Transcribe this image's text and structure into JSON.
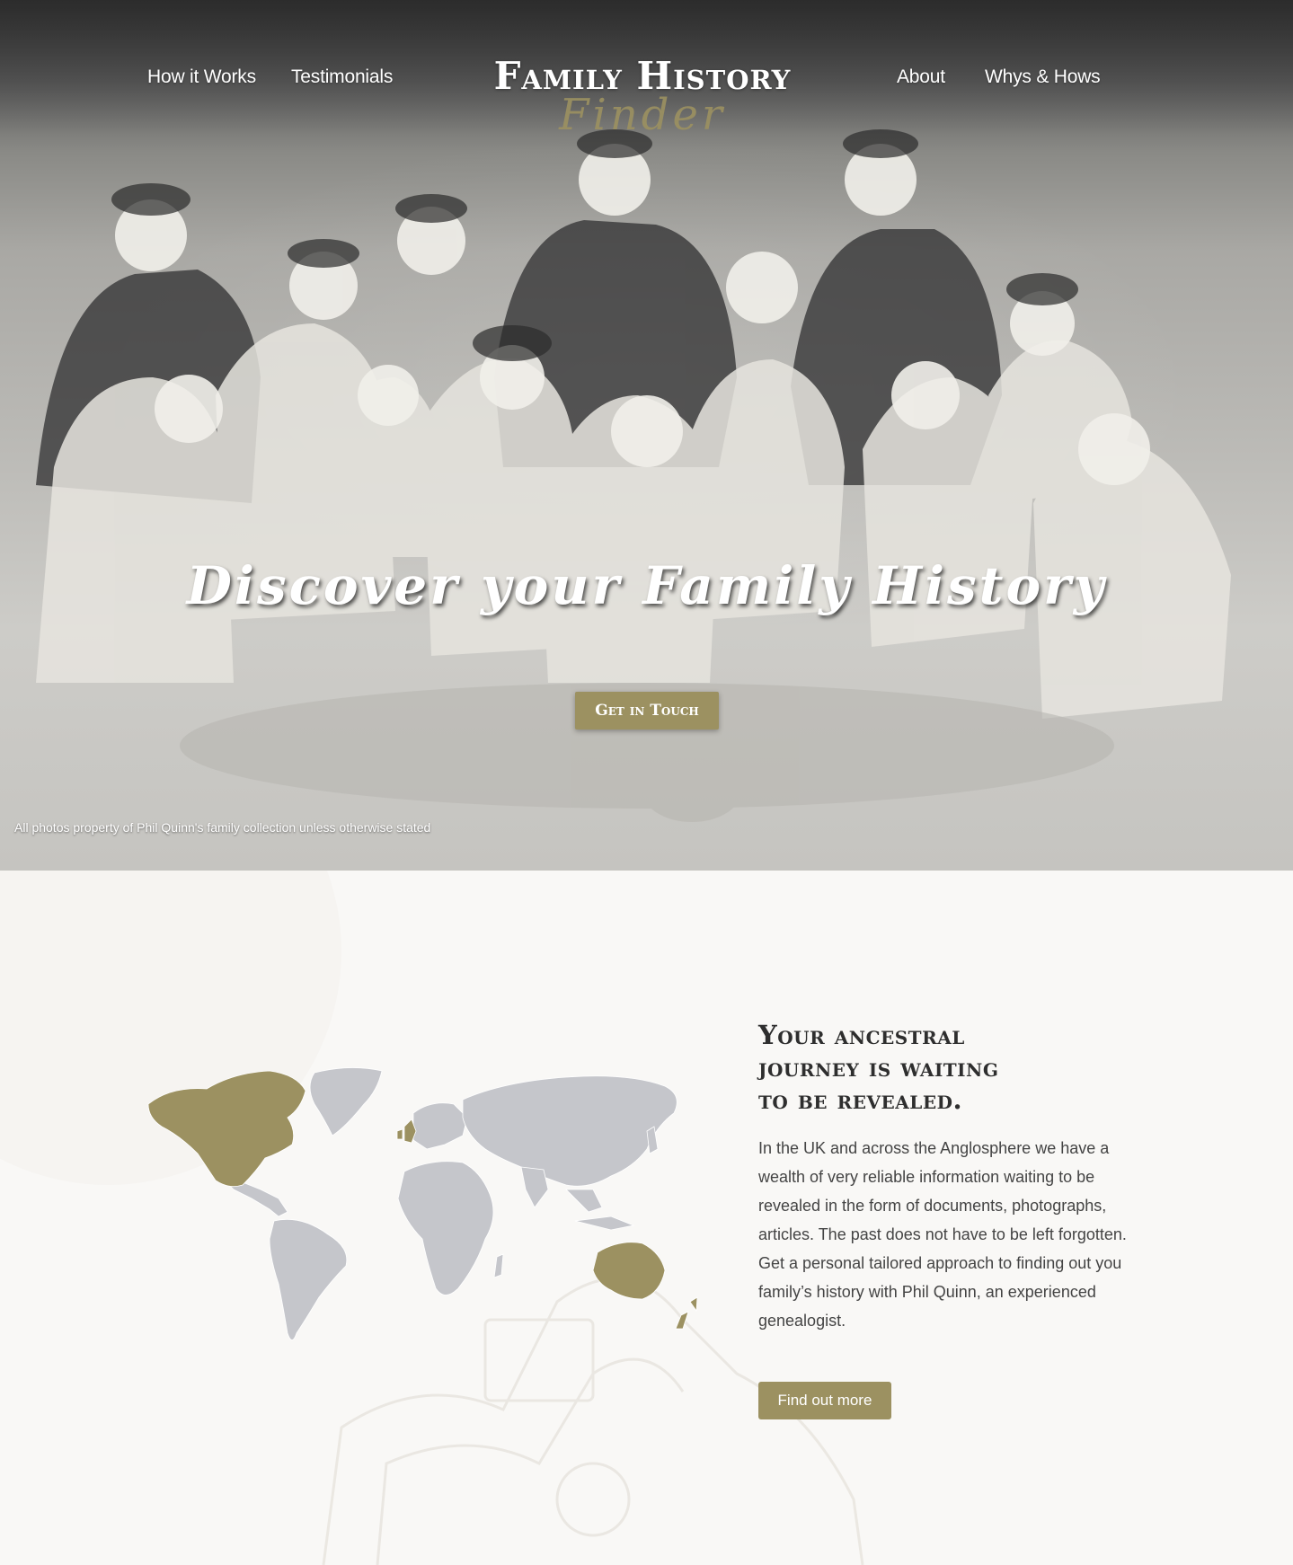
{
  "nav": {
    "left_items": [
      "How it Works",
      "Testimonials"
    ],
    "right_items": [
      "About",
      "Whys & Hows"
    ]
  },
  "logo": {
    "main": "Family History",
    "script": "Finder"
  },
  "hero": {
    "headline": "Discover your Family History",
    "cta_label": "Get in Touch",
    "photo_credit": "All photos property of Phil Quinn's family collection unless otherwise stated"
  },
  "intro": {
    "title_lines": [
      "Your ancestral",
      "journey is waiting",
      "to be revealed."
    ],
    "body": "In the UK and across the Anglosphere we have a wealth of very reliable information waiting to be revealed in the form of documents, photographs, articles. The past does not have to be left forgotten. Get a personal tailored approach to finding out you family’s history with Phil Quinn, an experienced genealogist.",
    "button_label": "Find out more"
  },
  "colors": {
    "accent": "#9c9161",
    "map_land": "#c5c6cb",
    "map_highlight": "#9c9161",
    "heading": "#2e2e2e",
    "body_text": "#444444"
  }
}
